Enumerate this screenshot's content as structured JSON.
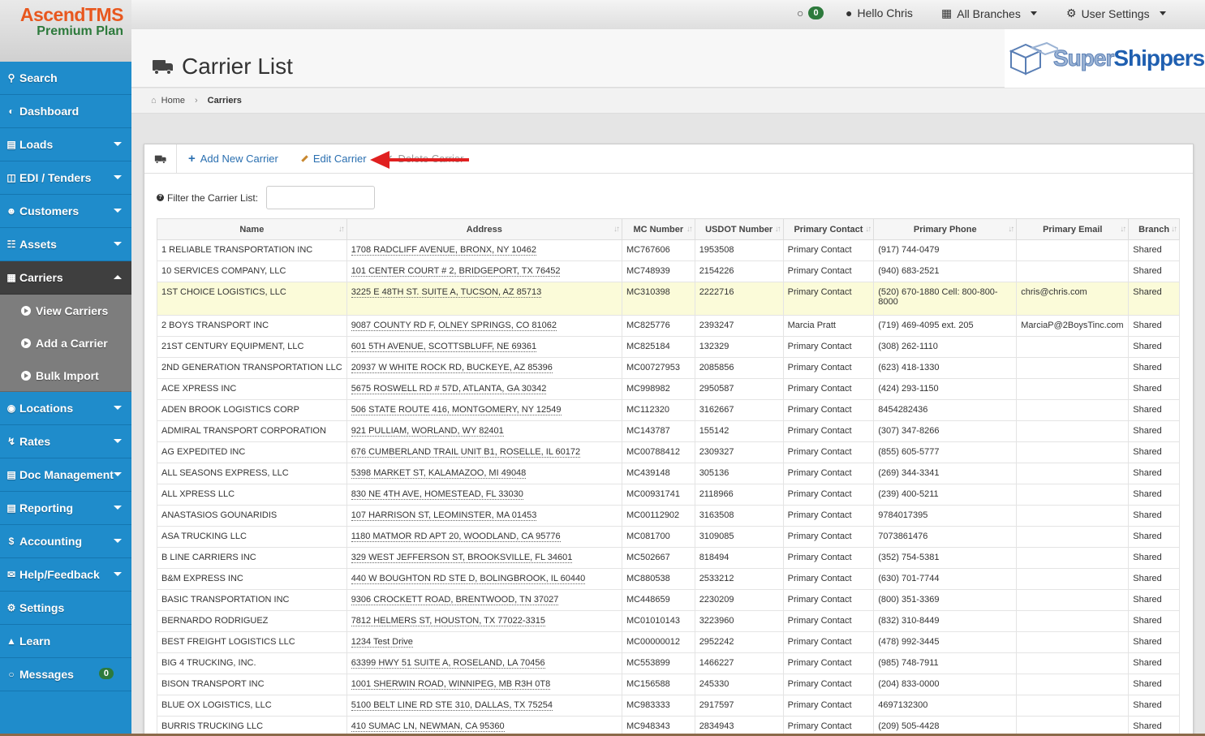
{
  "app": {
    "brand_name": "AscendTMS",
    "plan": "Premium Plan"
  },
  "topbar": {
    "messages_count": "0",
    "greeting": "Hello Chris",
    "branches": "All Branches",
    "user_settings": "User Settings"
  },
  "company_logo": {
    "part1": "Super",
    "part2": "Shippers"
  },
  "page": {
    "title": "Carrier List"
  },
  "breadcrumb": {
    "home": "Home",
    "current": "Carriers"
  },
  "sidebar": {
    "items": [
      {
        "label": "Search",
        "icon": "search-icon"
      },
      {
        "label": "Dashboard",
        "icon": "dashboard-icon"
      },
      {
        "label": "Loads",
        "icon": "list-icon"
      },
      {
        "label": "EDI / Tenders",
        "icon": "edi-icon"
      },
      {
        "label": "Customers",
        "icon": "users-icon"
      },
      {
        "label": "Assets",
        "icon": "barcode-icon"
      },
      {
        "label": "Carriers",
        "icon": "truck-icon"
      },
      {
        "label": "Locations",
        "icon": "map-pin-icon"
      },
      {
        "label": "Rates",
        "icon": "bolt-icon"
      },
      {
        "label": "Doc Management",
        "icon": "document-icon"
      },
      {
        "label": "Reporting",
        "icon": "report-icon"
      },
      {
        "label": "Accounting",
        "icon": "dollar-icon"
      },
      {
        "label": "Help/Feedback",
        "icon": "megaphone-icon"
      },
      {
        "label": "Settings",
        "icon": "gears-icon"
      },
      {
        "label": "Learn",
        "icon": "graduation-cap-icon"
      },
      {
        "label": "Messages",
        "icon": "chat-icon",
        "badge": "0"
      }
    ],
    "carriers_sub": [
      {
        "label": "View Carriers"
      },
      {
        "label": "Add a Carrier"
      },
      {
        "label": "Bulk Import"
      }
    ]
  },
  "toolbar": {
    "add": "Add New Carrier",
    "edit": "Edit Carrier",
    "delete": "Delete Carrier"
  },
  "filter": {
    "label": "Filter the Carrier List:",
    "value": ""
  },
  "table": {
    "columns": [
      "Name",
      "Address",
      "MC Number",
      "USDOT Number",
      "Primary Contact",
      "Primary Phone",
      "Primary Email",
      "Branch"
    ],
    "rows": [
      [
        "1 RELIABLE TRANSPORTATION INC",
        "1708 RADCLIFF AVENUE, BRONX, NY 10462",
        "MC767606",
        "1953508",
        "Primary Contact",
        "(917) 744-0479",
        "",
        "Shared"
      ],
      [
        "10 SERVICES COMPANY, LLC",
        "101 CENTER COURT # 2, BRIDGEPORT, TX 76452",
        "MC748939",
        "2154226",
        "Primary Contact",
        "(940) 683-2521",
        "",
        "Shared"
      ],
      [
        "1ST CHOICE LOGISTICS, LLC",
        "3225 E 48TH ST. SUITE A, TUCSON, AZ 85713",
        "MC310398",
        "2222716",
        "Primary Contact",
        "(520) 670-1880 Cell: 800-800-8000",
        "chris@chris.com",
        "Shared"
      ],
      [
        "2 BOYS TRANSPORT INC",
        "9087 COUNTY RD F, OLNEY SPRINGS, CO 81062",
        "MC825776",
        "2393247",
        "Marcia Pratt",
        "(719) 469-4095 ext. 205",
        "MarciaP@2BoysTinc.com",
        "Shared"
      ],
      [
        "21ST CENTURY EQUIPMENT, LLC",
        "601 5TH AVENUE, SCOTTSBLUFF, NE 69361",
        "MC825184",
        "132329",
        "Primary Contact",
        "(308) 262-1110",
        "",
        "Shared"
      ],
      [
        "2ND GENERATION TRANSPORTATION LLC",
        "20937 W WHITE ROCK RD, BUCKEYE, AZ 85396",
        "MC00727953",
        "2085856",
        "Primary Contact",
        "(623) 418-1330",
        "",
        "Shared"
      ],
      [
        "ACE XPRESS INC",
        "5675 ROSWELL RD # 57D, ATLANTA, GA 30342",
        "MC998982",
        "2950587",
        "Primary Contact",
        "(424) 293-1150",
        "",
        "Shared"
      ],
      [
        "ADEN BROOK LOGISTICS CORP",
        "506 STATE ROUTE 416, MONTGOMERY, NY 12549",
        "MC112320",
        "3162667",
        "Primary Contact",
        "8454282436",
        "",
        "Shared"
      ],
      [
        "ADMIRAL TRANSPORT CORPORATION",
        "921 PULLIAM, WORLAND, WY 82401",
        "MC143787",
        "155142",
        "Primary Contact",
        "(307) 347-8266",
        "",
        "Shared"
      ],
      [
        "AG EXPEDITED INC",
        "676 CUMBERLAND TRAIL UNIT B1, ROSELLE, IL 60172",
        "MC00788412",
        "2309327",
        "Primary Contact",
        "(855) 605-5777",
        "",
        "Shared"
      ],
      [
        "ALL SEASONS EXPRESS, LLC",
        "5398 MARKET ST, KALAMAZOO, MI 49048",
        "MC439148",
        "305136",
        "Primary Contact",
        "(269) 344-3341",
        "",
        "Shared"
      ],
      [
        "ALL XPRESS LLC",
        "830 NE 4TH AVE, HOMESTEAD, FL 33030",
        "MC00931741",
        "2118966",
        "Primary Contact",
        "(239) 400-5211",
        "",
        "Shared"
      ],
      [
        "ANASTASIOS GOUNARIDIS",
        "107 HARRISON ST, LEOMINSTER, MA 01453",
        "MC00112902",
        "3163508",
        "Primary Contact",
        "9784017395",
        "",
        "Shared"
      ],
      [
        "ASA TRUCKING LLC",
        "1180 MATMOR RD APT 20, WOODLAND, CA 95776",
        "MC081700",
        "3109085",
        "Primary Contact",
        "7073861476",
        "",
        "Shared"
      ],
      [
        "B LINE CARRIERS INC",
        "329 WEST JEFFERSON ST, BROOKSVILLE, FL 34601",
        "MC502667",
        "818494",
        "Primary Contact",
        "(352) 754-5381",
        "",
        "Shared"
      ],
      [
        "B&M EXPRESS INC",
        "440 W BOUGHTON RD STE D, BOLINGBROOK, IL 60440",
        "MC880538",
        "2533212",
        "Primary Contact",
        "(630) 701-7744",
        "",
        "Shared"
      ],
      [
        "BASIC TRANSPORTATION INC",
        "9306 CROCKETT ROAD, BRENTWOOD, TN 37027",
        "MC448659",
        "2230209",
        "Primary Contact",
        "(800) 351-3369",
        "",
        "Shared"
      ],
      [
        "BERNARDO RODRIGUEZ",
        "7812 HELMERS ST, HOUSTON, TX 77022-3315",
        "MC01010143",
        "3223960",
        "Primary Contact",
        "(832) 310-8449",
        "",
        "Shared"
      ],
      [
        "BEST FREIGHT LOGISTICS LLC",
        "1234 Test Drive",
        "MC00000012",
        "2952242",
        "Primary Contact",
        "(478) 992-3445",
        "",
        "Shared"
      ],
      [
        "BIG 4 TRUCKING, INC.",
        "63399 HWY 51 SUITE A, ROSELAND, LA 70456",
        "MC553899",
        "1466227",
        "Primary Contact",
        "(985) 748-7911",
        "",
        "Shared"
      ],
      [
        "BISON TRANSPORT INC",
        "1001 SHERWIN ROAD, WINNIPEG, MB R3H 0T8",
        "MC156588",
        "245330",
        "Primary Contact",
        "(204) 833-0000",
        "",
        "Shared"
      ],
      [
        "BLUE OX LOGISTICS, LLC",
        "5100 BELT LINE RD STE 310, DALLAS, TX 75254",
        "MC983333",
        "2917597",
        "Primary Contact",
        "4697132300",
        "",
        "Shared"
      ],
      [
        "BURRIS TRUCKING LLC",
        "410 SUMAC LN, NEWMAN, CA 95360",
        "MC948343",
        "2834943",
        "Primary Contact",
        "(209) 505-4428",
        "",
        "Shared"
      ]
    ]
  }
}
